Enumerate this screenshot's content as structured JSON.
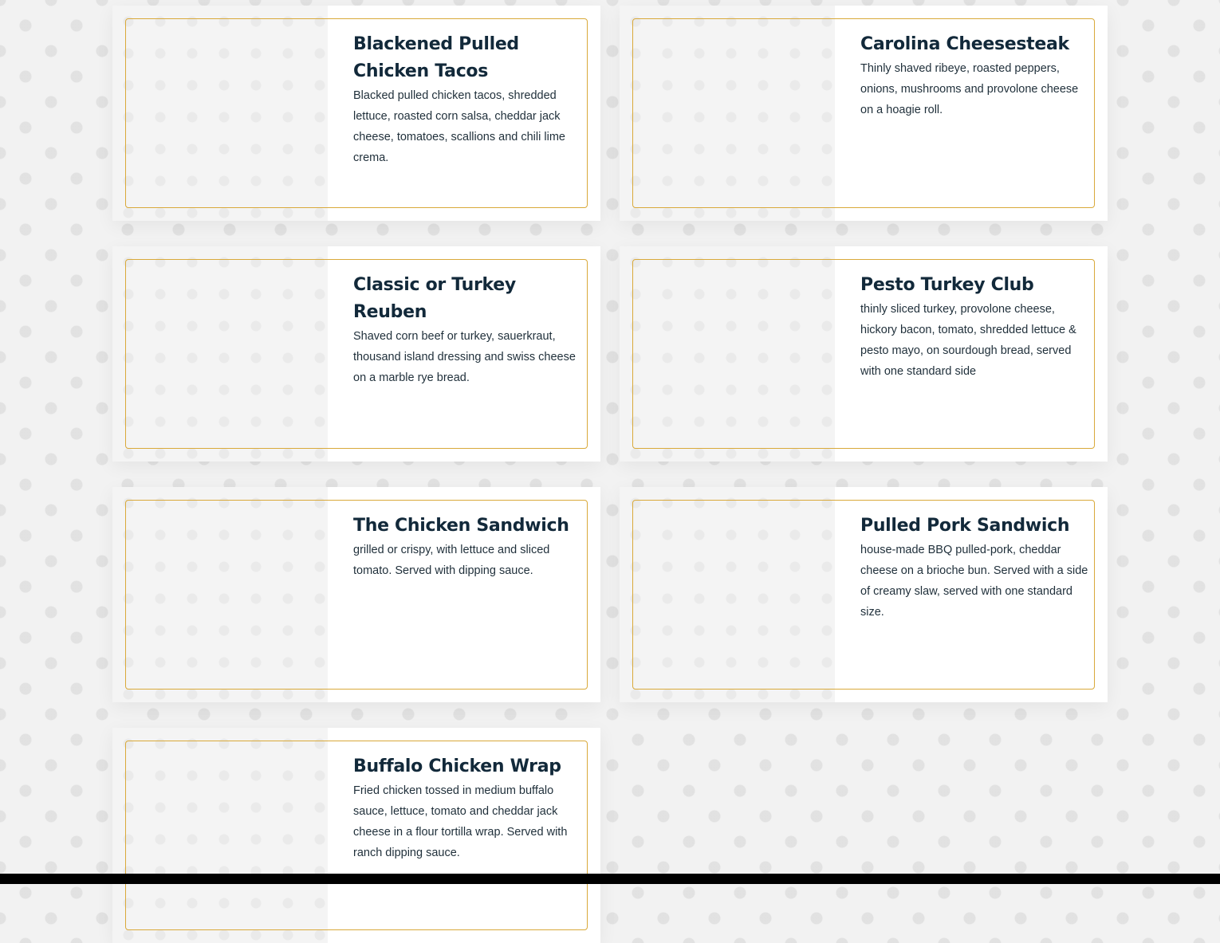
{
  "menu": {
    "items": [
      {
        "title": "Blackened Pulled Chicken Tacos",
        "description": "Blacked pulled chicken tacos, shredded lettuce, roasted corn salsa, cheddar jack cheese, tomatoes, scallions and chili lime crema."
      },
      {
        "title": "Carolina Cheesesteak",
        "description": "Thinly shaved ribeye, roasted peppers, onions, mushrooms and provolone cheese on a hoagie roll."
      },
      {
        "title": "Classic or Turkey Reuben",
        "description": "Shaved corn beef or turkey, sauerkraut, thousand island dressing and swiss cheese on a marble rye bread."
      },
      {
        "title": "Pesto Turkey Club",
        "description": "thinly sliced turkey, provolone cheese, hickory bacon, tomato, shredded lettuce & pesto mayo, on sourdough bread, served with one standard side"
      },
      {
        "title": "The Chicken Sandwich",
        "description": "grilled or crispy, with lettuce and sliced tomato. Served with dipping sauce."
      },
      {
        "title": "Pulled Pork Sandwich",
        "description": "house-made BBQ pulled-pork, cheddar cheese on a brioche bun. Served with a side of creamy slaw, served with one standard size."
      },
      {
        "title": "Buffalo Chicken Wrap",
        "description": "Fried chicken tossed in medium buffalo sauce, lettuce, tomato and cheddar jack cheese in a flour tortilla wrap. Served with ranch dipping sauce."
      }
    ]
  },
  "colors": {
    "accent_border": "#d9a93a",
    "title_text": "#12293a",
    "body_text": "#1f2f3a",
    "card_background": "#ffffff",
    "page_background": "#f2f2f2"
  }
}
